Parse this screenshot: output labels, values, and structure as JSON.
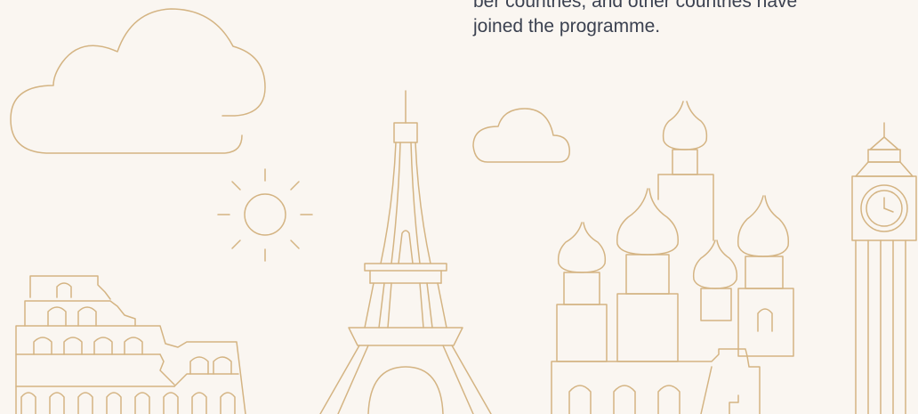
{
  "intro": {
    "line1": "ber countries, and other countries have",
    "line2": "joined the programme."
  },
  "illustration": {
    "line_color": "#d4b483",
    "background": "#faf6f1",
    "landmarks": [
      "colosseum-icon",
      "eiffel-tower-icon",
      "st-basils-cathedral-icon",
      "big-ben-icon",
      "cloud-icon",
      "sun-icon"
    ]
  }
}
